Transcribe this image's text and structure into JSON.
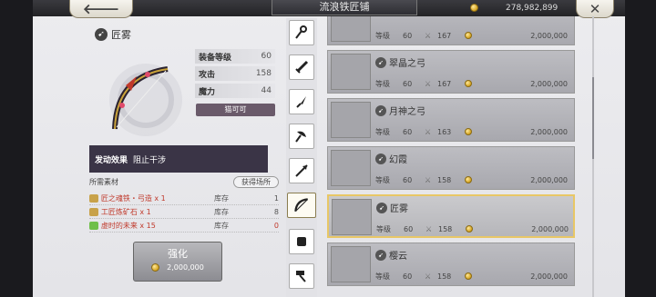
{
  "header": {
    "back_icon": "arrow-left-icon",
    "title": "流浪铁匠铺",
    "coins": "278,982,899",
    "close_icon": "close-icon"
  },
  "detail": {
    "name": "匠雾",
    "stats": [
      {
        "label": "装备等级",
        "value": "60"
      },
      {
        "label": "攻击",
        "value": "158"
      },
      {
        "label": "魔力",
        "value": "44"
      }
    ],
    "owner": "猫可可",
    "effect_key": "发动效果",
    "effect_value": "阻止干涉",
    "materials_label": "所需素材",
    "obtain_label": "获得场所",
    "materials": [
      {
        "name": "匠之魂铁・弓造 x 1",
        "stock_label": "库存",
        "count": "1",
        "color": "#c8a24a"
      },
      {
        "name": "工匠炼矿石 x 1",
        "stock_label": "库存",
        "count": "8",
        "color": "#c8a24a"
      },
      {
        "name": "虚时的未来 x 15",
        "stock_label": "库存",
        "count": "0",
        "color": "#6fbf4a"
      }
    ],
    "enhance_label": "强化",
    "enhance_cost": "2,000,000"
  },
  "tabs": [
    "staff-icon",
    "sword-icon",
    "dagger-icon",
    "axe-icon",
    "spear-icon",
    "bow-icon",
    "gauntlet-icon",
    "hammer-icon"
  ],
  "list": [
    {
      "name": "",
      "level_label": "等级",
      "level": "60",
      "attack": "167",
      "price": "2,000,000"
    },
    {
      "name": "翠晶之弓",
      "level_label": "等级",
      "level": "60",
      "attack": "167",
      "price": "2,000,000"
    },
    {
      "name": "月神之弓",
      "level_label": "等级",
      "level": "60",
      "attack": "163",
      "price": "2,000,000"
    },
    {
      "name": "幻霞",
      "level_label": "等级",
      "level": "60",
      "attack": "158",
      "price": "2,000,000"
    },
    {
      "name": "匠雾",
      "level_label": "等级",
      "level": "60",
      "attack": "158",
      "price": "2,000,000"
    },
    {
      "name": "樱云",
      "level_label": "等级",
      "level": "60",
      "attack": "158",
      "price": "2,000,000"
    }
  ]
}
